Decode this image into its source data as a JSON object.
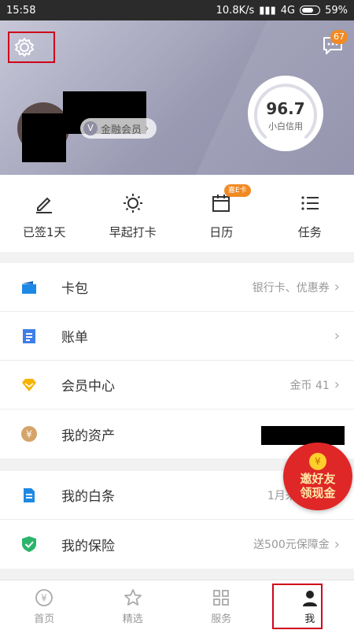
{
  "status_bar": {
    "time": "15:58",
    "network_speed": "10.8K/s",
    "signal": "4G",
    "battery": "59%"
  },
  "header": {
    "message_badge": "67",
    "member_label": "金融会员",
    "credit_score": "96.7",
    "credit_label": "小白信用"
  },
  "quick_actions": [
    {
      "label": "已签1天",
      "icon": "pen-icon"
    },
    {
      "label": "早起打卡",
      "icon": "sun-icon"
    },
    {
      "label": "日历",
      "icon": "calendar-icon",
      "badge": "嘉E卡"
    },
    {
      "label": "任务",
      "icon": "list-icon"
    }
  ],
  "section1": [
    {
      "title": "卡包",
      "sub": "银行卡、优惠券",
      "icon": "card-wallet-icon",
      "color": "#1e88e5"
    },
    {
      "title": "账单",
      "sub": "",
      "icon": "bill-icon",
      "color": "#3f7ee8"
    },
    {
      "title": "会员中心",
      "sub": "金币 41",
      "icon": "diamond-icon",
      "color": "#f5b400"
    },
    {
      "title": "我的资产",
      "sub": "",
      "icon": "yuan-coin-icon",
      "color": "#d4a46a"
    }
  ],
  "section2": [
    {
      "title": "我的白条",
      "sub": "1月未出账单",
      "icon": "ious-icon",
      "color": "#1e88e5"
    },
    {
      "title": "我的保险",
      "sub": "送500元保障金",
      "icon": "shield-check-icon",
      "color": "#2bb56b"
    }
  ],
  "promo": {
    "line1": "邀好友",
    "line2": "领现金"
  },
  "tabs": [
    {
      "label": "首页",
      "icon": "home-yuan-icon"
    },
    {
      "label": "精选",
      "icon": "star-icon"
    },
    {
      "label": "服务",
      "icon": "grid-icon"
    },
    {
      "label": "我",
      "icon": "person-icon"
    }
  ],
  "colors": {
    "accent": "#d0021b",
    "badge": "#f08a24",
    "header_start": "#c7c7d8",
    "header_end": "#8d8da9"
  }
}
